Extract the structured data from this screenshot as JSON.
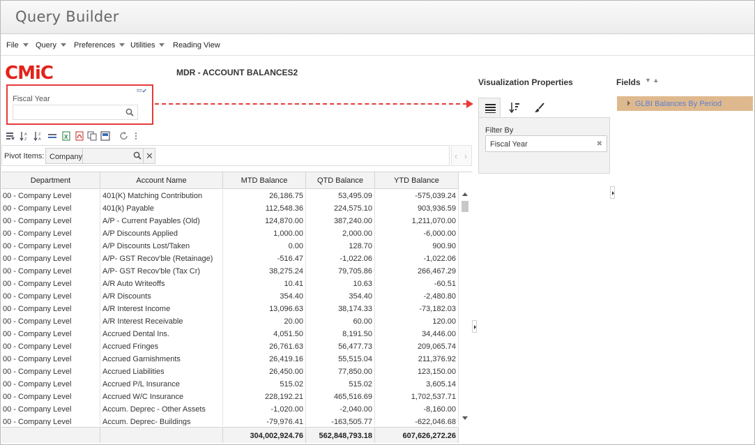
{
  "app": {
    "title": "Query Builder"
  },
  "menu": [
    {
      "label": "File",
      "has_dropdown": true
    },
    {
      "label": "Query",
      "has_dropdown": true
    },
    {
      "label": "Preferences",
      "has_dropdown": true
    },
    {
      "label": "Utilities",
      "has_dropdown": true
    },
    {
      "label": "Reading View",
      "has_dropdown": false
    }
  ],
  "logo": {
    "text": "CMiC",
    "color": "#e2231a"
  },
  "report": {
    "title": "MDR - ACCOUNT BALANCES2"
  },
  "prompt": {
    "label": "Fiscal Year",
    "value": "",
    "highlight_color": "#e53b3b"
  },
  "toolbar": {
    "icons": [
      "filter-list-icon",
      "sort-ascending-icon",
      "sort-descending-icon",
      "column-settings-icon",
      "export-excel-icon",
      "export-pdf-icon",
      "copy-icon",
      "save-view-icon",
      "refresh-icon",
      "more-options-icon"
    ]
  },
  "pivot": {
    "label": "Pivot Items:",
    "chip": "Company"
  },
  "grid": {
    "columns": [
      "Department",
      "Account Name",
      "MTD Balance",
      "QTD Balance",
      "YTD Balance"
    ],
    "rows": [
      [
        "00 - Company Level",
        "401(K) Matching Contribution",
        "26,186.75",
        "53,495.09",
        "-575,039.24"
      ],
      [
        "00 - Company Level",
        "401(k) Payable",
        "112,548.36",
        "224,575.10",
        "903,936.59"
      ],
      [
        "00 - Company Level",
        "A/P - Current Payables (Old)",
        "124,870.00",
        "387,240.00",
        "1,211,070.00"
      ],
      [
        "00 - Company Level",
        "A/P Discounts Applied",
        "1,000.00",
        "2,000.00",
        "-6,000.00"
      ],
      [
        "00 - Company Level",
        "A/P Discounts Lost/Taken",
        "0.00",
        "128.70",
        "900.90"
      ],
      [
        "00 - Company Level",
        "A/P- GST Recov'ble (Retainage)",
        "-516.47",
        "-1,022.06",
        "-1,022.06"
      ],
      [
        "00 - Company Level",
        "A/P- GST Recov'ble (Tax Cr)",
        "38,275.24",
        "79,705.86",
        "266,467.29"
      ],
      [
        "00 - Company Level",
        "A/R Auto Writeoffs",
        "10.41",
        "10.63",
        "-60.51"
      ],
      [
        "00 - Company Level",
        "A/R Discounts",
        "354.40",
        "354.40",
        "-2,480.80"
      ],
      [
        "00 - Company Level",
        "A/R Interest Income",
        "13,096.63",
        "38,174.33",
        "-73,182.03"
      ],
      [
        "00 - Company Level",
        "A/R Interest Receivable",
        "20.00",
        "60.00",
        "120.00"
      ],
      [
        "00 - Company Level",
        "Accrued Dental Ins.",
        "4,051.50",
        "8,191.50",
        "34,446.00"
      ],
      [
        "00 - Company Level",
        "Accrued Fringes",
        "26,761.63",
        "56,477.73",
        "209,065.74"
      ],
      [
        "00 - Company Level",
        "Accrued Garnishments",
        "26,419.16",
        "55,515.04",
        "211,376.92"
      ],
      [
        "00 - Company Level",
        "Accrued Liabilities",
        "26,450.00",
        "77,850.00",
        "123,150.00"
      ],
      [
        "00 - Company Level",
        "Accrued P/L Insurance",
        "515.02",
        "515.02",
        "3,605.14"
      ],
      [
        "00 - Company Level",
        "Accrued W/C Insurance",
        "228,192.21",
        "465,516.69",
        "1,702,537.71"
      ],
      [
        "00 - Company Level",
        "Accum. Deprec - Other Assets",
        "-1,020.00",
        "-2,040.00",
        "-8,160.00"
      ],
      [
        "00 - Company Level",
        "Accum. Deprec- Buildings",
        "-79,976.41",
        "-163,505.77",
        "-622,046.68"
      ]
    ],
    "totals": [
      "304,002,924.76",
      "562,848,793.18",
      "607,626,272.26"
    ]
  },
  "visualization": {
    "title": "Visualization Properties",
    "tabs": [
      "list-icon",
      "sort-icon",
      "brush-icon"
    ],
    "filter_label": "Filter By",
    "filter_chip": "Fiscal Year"
  },
  "fields": {
    "title": "Fields",
    "items": [
      "GLBI Balances By Period"
    ],
    "highlight_color": "#dfb98e"
  }
}
